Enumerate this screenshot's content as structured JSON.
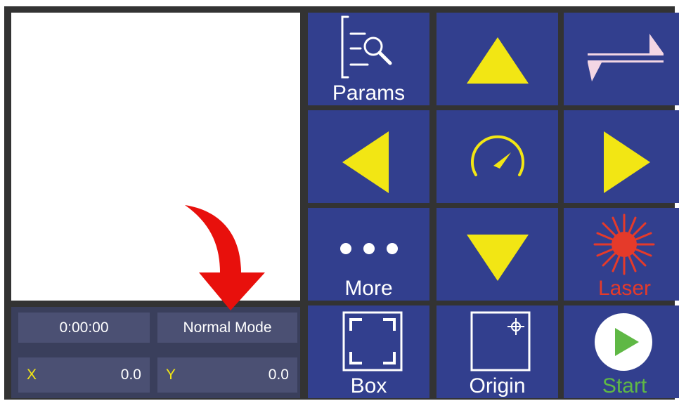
{
  "status": {
    "timer": "0:00:00",
    "mode": "Normal Mode",
    "x_label": "X",
    "x_value": "0.0",
    "y_label": "Y",
    "y_value": "0.0"
  },
  "buttons": {
    "params": "Params",
    "more": "More",
    "laser": "Laser",
    "box": "Box",
    "origin": "Origin",
    "start": "Start"
  },
  "colors": {
    "button_bg": "#323f8e",
    "arrow_yellow": "#f2e614",
    "laser_red": "#e53a2a",
    "start_green": "#5fb845",
    "highlight_arrow": "#e8100c"
  },
  "icons": {
    "params": "document-search-icon",
    "up": "arrow-up-icon",
    "speed_toggle": "swap-speed-icon",
    "left": "arrow-left-icon",
    "speed": "speedometer-icon",
    "right": "arrow-right-icon",
    "more": "ellipsis-icon",
    "down": "arrow-down-icon",
    "laser": "laser-burst-icon",
    "box": "frame-corners-icon",
    "origin": "crosshair-box-icon",
    "start": "play-icon"
  }
}
